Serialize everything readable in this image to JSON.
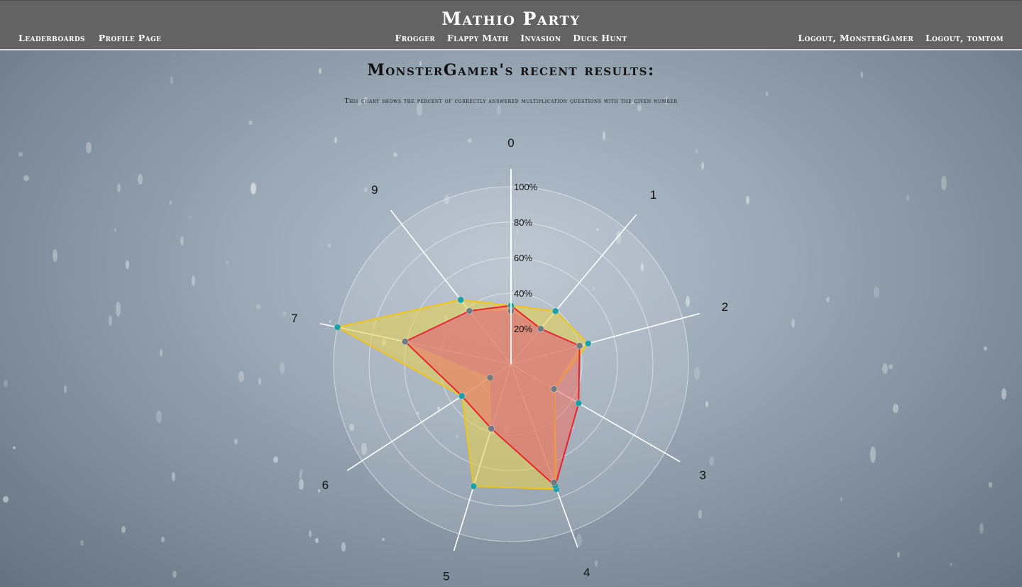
{
  "header": {
    "title": "Mathio Party",
    "nav_left": [
      "Leaderboards",
      "Profile Page"
    ],
    "nav_center": [
      "Frogger",
      "Flappy Math",
      "Invasion",
      "Duck Hunt"
    ],
    "nav_right": [
      "Logout, MonsterGamer",
      "Logout, tomtom"
    ]
  },
  "main": {
    "heading": "MonsterGamer's recent results:",
    "description": "This chart shows the percent of correctly answered multiplication questions with the given number"
  },
  "colors": {
    "topbar": "#636363",
    "series_yellow_stroke": "#f0c419",
    "series_yellow_fill": "#e8d24a",
    "series_red_stroke": "#e8232a",
    "series_red_fill": "#f07060",
    "point_teal": "#1ba0a6",
    "point_gray": "#707a80"
  },
  "chart_data": {
    "type": "radar",
    "categories": [
      "0",
      "1",
      "2",
      "3",
      "4",
      "5",
      "6",
      "7",
      "9"
    ],
    "rlim": [
      0,
      100
    ],
    "ticks": [
      "20%",
      "40%",
      "60%",
      "80%",
      "100%"
    ],
    "grid": true,
    "series": [
      {
        "color": "#f0c419",
        "values": [
          33,
          39,
          45,
          28,
          75,
          72,
          33,
          100,
          46
        ]
      },
      {
        "color": "#e8232a",
        "values": [
          33,
          26,
          40,
          44,
          73,
          38,
          33,
          61,
          38
        ]
      },
      {
        "color": "#9a8fb0",
        "values": [
          30,
          26,
          40,
          28,
          71,
          38,
          14,
          61,
          38
        ]
      }
    ]
  }
}
